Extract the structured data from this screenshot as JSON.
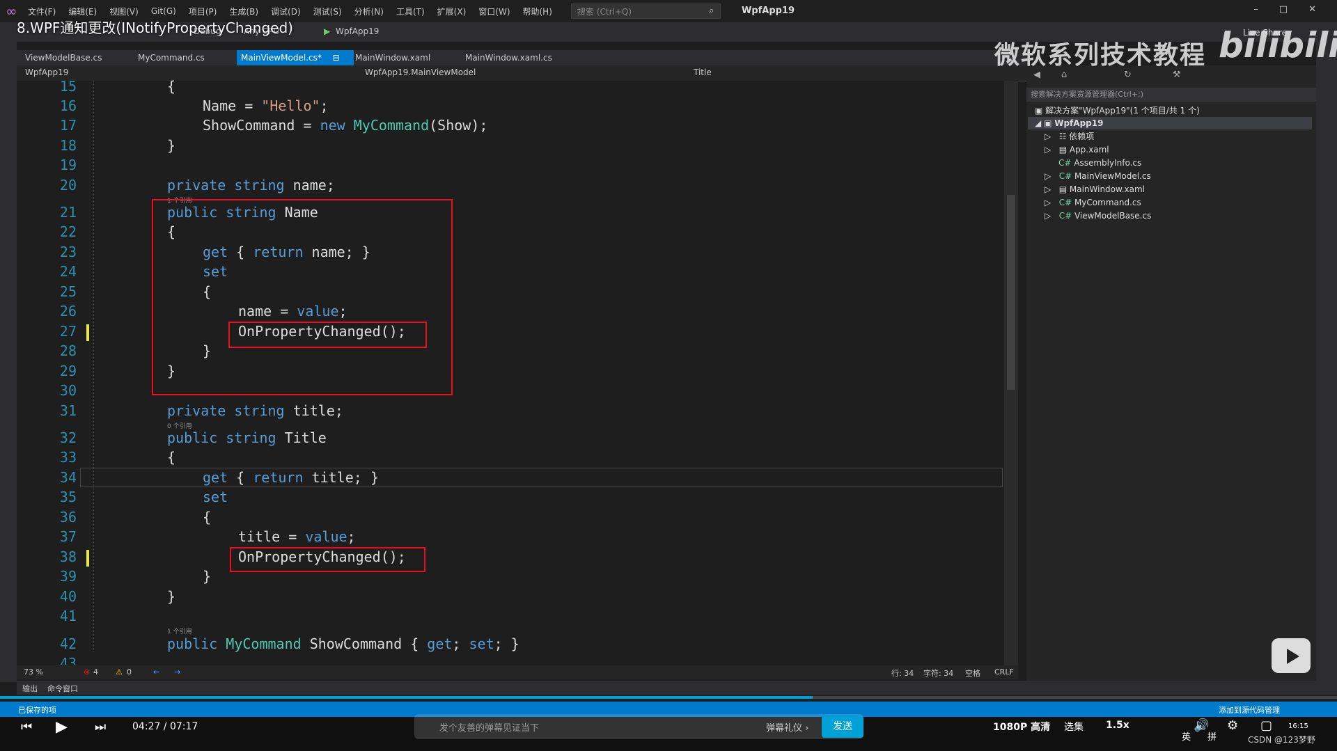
{
  "window": {
    "app_name": "WpfApp19",
    "menu": [
      "文件(F)",
      "编辑(E)",
      "视图(V)",
      "Git(G)",
      "项目(P)",
      "生成(B)",
      "调试(D)",
      "测试(S)",
      "分析(N)",
      "工具(T)",
      "扩展(X)",
      "窗口(W)",
      "帮助(H)"
    ],
    "search_placeholder": "搜索 (Ctrl+Q)",
    "live_share": "Live Share"
  },
  "toolbar": {
    "config": "Debug",
    "platform": "Any CPU",
    "run_target": "WpfApp19"
  },
  "overlay": {
    "video_title": "8.WPF通知更改(INotifyPropertyChanged)",
    "watermark": "微软系列技术教程",
    "site_logo": "bilibili"
  },
  "tabs": [
    {
      "label": "ViewModelBase.cs",
      "active": false
    },
    {
      "label": "MyCommand.cs",
      "active": false
    },
    {
      "label": "MainViewModel.cs*",
      "active": true
    },
    {
      "label": "MainWindow.xaml",
      "active": false
    },
    {
      "label": "MainWindow.xaml.cs",
      "active": false
    }
  ],
  "navbar": {
    "project": "WpfApp19",
    "class": "WpfApp19.MainViewModel",
    "member": "Title"
  },
  "code_lines": [
    {
      "n": "15",
      "text": "{"
    },
    {
      "n": "16",
      "text": "Name = \"Hello\";"
    },
    {
      "n": "17",
      "text": "ShowCommand = new MyCommand(Show);"
    },
    {
      "n": "18",
      "text": "}"
    },
    {
      "n": "19",
      "text": ""
    },
    {
      "n": "20",
      "text": "private string name;"
    },
    {
      "n": "21",
      "text": "public string Name"
    },
    {
      "n": "22",
      "text": "{"
    },
    {
      "n": "23",
      "text": "get { return name; }"
    },
    {
      "n": "24",
      "text": "set"
    },
    {
      "n": "25",
      "text": "{"
    },
    {
      "n": "26",
      "text": "name = value;"
    },
    {
      "n": "27",
      "text": "OnPropertyChanged();"
    },
    {
      "n": "28",
      "text": "}"
    },
    {
      "n": "29",
      "text": "}"
    },
    {
      "n": "30",
      "text": ""
    },
    {
      "n": "31",
      "text": "private string title;"
    },
    {
      "n": "32",
      "text": "public string Title"
    },
    {
      "n": "33",
      "text": "{"
    },
    {
      "n": "34",
      "text": "get { return title; }"
    },
    {
      "n": "35",
      "text": "set"
    },
    {
      "n": "36",
      "text": "{"
    },
    {
      "n": "37",
      "text": "title = value;"
    },
    {
      "n": "38",
      "text": "OnPropertyChanged();"
    },
    {
      "n": "39",
      "text": "}"
    },
    {
      "n": "40",
      "text": "}"
    },
    {
      "n": "41",
      "text": ""
    },
    {
      "n": "42",
      "text": "public MyCommand ShowCommand { get; set; }"
    },
    {
      "n": "43",
      "text": ""
    }
  ],
  "codelens": {
    "line21": "1 个引用",
    "line32": "0 个引用",
    "line42": "1 个引用"
  },
  "editor_status": {
    "zoom": "73 %",
    "errors": "4",
    "warnings": "0",
    "position": "行: 34",
    "char": "字符: 34",
    "spaces": "空格",
    "eol": "CRLF"
  },
  "solution_explorer": {
    "search_placeholder": "搜索解决方案资源管理器(Ctrl+;)",
    "solution": "解决方案\"WpfApp19\"(1 个项目/共 1 个)",
    "project": "WpfApp19",
    "items": [
      "依赖项",
      "App.xaml",
      "AssemblyInfo.cs",
      "MainViewModel.cs",
      "MainWindow.xaml",
      "MyCommand.cs",
      "ViewModelBase.cs"
    ]
  },
  "bottom_tabs": [
    "输出",
    "命令窗口"
  ],
  "statusbar": {
    "left": "已保存的项",
    "right": "添加到源代码管理"
  },
  "player": {
    "time": "04:27 / 07:17",
    "progress_fraction": 0.608,
    "danmaku_placeholder": "发个友善的弹幕见证当下",
    "danmaku_etiquette": "弹幕礼仪 ›",
    "send": "发送",
    "quality": "1080P 高清",
    "episodes": "选集",
    "speed": "1.5x",
    "ime_lang": "英",
    "ime_mode": "拼",
    "clock": "16:15",
    "credit": "CSDN @123梦野"
  },
  "colors": {
    "keyword": "#569cd6",
    "type": "#4ec9b0",
    "string": "#d69d85",
    "linenumber": "#2b91af",
    "highlight": "#e81123",
    "accent": "#007acc"
  }
}
